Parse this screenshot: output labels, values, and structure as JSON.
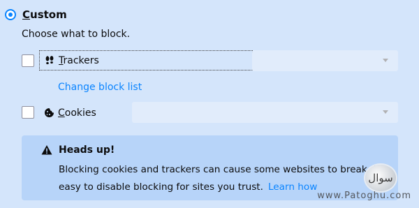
{
  "custom": {
    "label_underlined": "C",
    "label_rest": "ustom",
    "selected": true
  },
  "subtitle": "Choose what to block.",
  "trackers": {
    "label_underlined": "T",
    "label_rest": "rackers",
    "checked": false,
    "icon": "footprints-icon",
    "select_value": ""
  },
  "change_block_list": "Change block list",
  "cookies": {
    "label_underlined": "C",
    "label_rest": "ookies",
    "checked": false,
    "icon": "cookie-icon",
    "select_value": ""
  },
  "notice": {
    "icon": "warning-icon",
    "title": "Heads up!",
    "body": "Blocking cookies and trackers can cause some websites to break. It’s easy to disable blocking for sites you trust.",
    "learn_more": "Learn how"
  },
  "watermark": {
    "badge": "سوال",
    "text": "www.Patoghu.com"
  },
  "colors": {
    "background": "#d4e5fb",
    "accent": "#0a84ff",
    "notice_bg": "#b7d4f9",
    "select_bg": "#e1ecfb"
  }
}
